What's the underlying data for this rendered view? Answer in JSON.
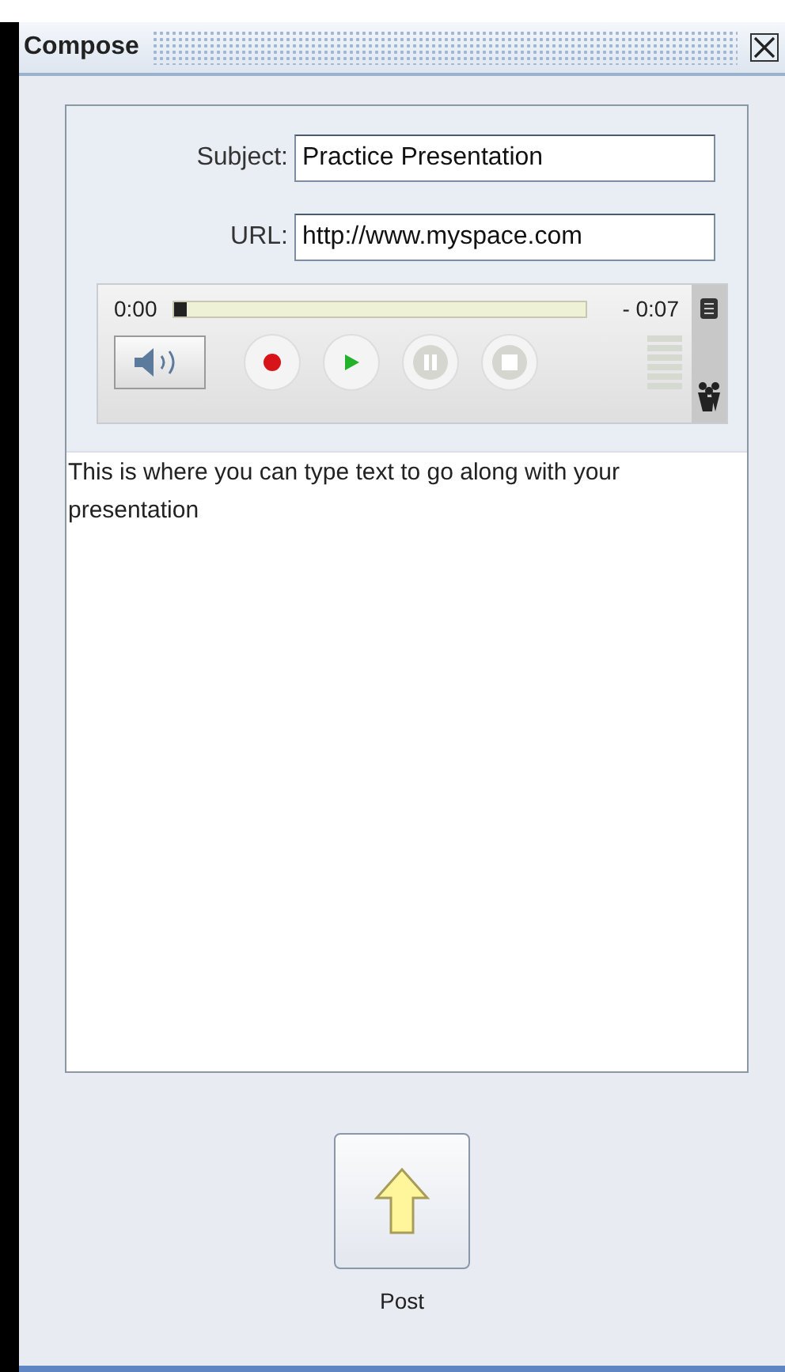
{
  "window": {
    "title": "Compose"
  },
  "fields": [
    {
      "label": "Subject:",
      "value": "Practice Presentation"
    },
    {
      "label": "URL:",
      "value": "http://www.myspace.com"
    }
  ],
  "player": {
    "elapsed": "0:00",
    "remaining": "- 0:07",
    "level": 0.03
  },
  "body": {
    "value": "This is where you can type text to go along with your presentation"
  },
  "post_button": {
    "label": "Post"
  }
}
